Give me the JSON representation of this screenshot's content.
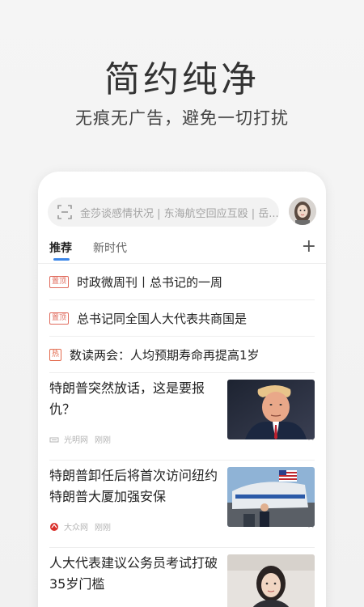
{
  "promo": {
    "title": "简约纯净",
    "subtitle": "无痕无广告，避免一切打扰"
  },
  "search": {
    "hint": "金莎谈感情状况 | 东海航空回应互殴 | 岳..."
  },
  "tabs": [
    {
      "label": "推荐"
    },
    {
      "label": "新时代"
    }
  ],
  "top_items": [
    {
      "tag": "置顶",
      "text": "时政微周刊丨总书记的一周"
    },
    {
      "tag": "置顶",
      "text": "总书记同全国人大代表共商国是"
    },
    {
      "tag": "热",
      "text": "数读两会：人均预期寿命再提高1岁"
    }
  ],
  "news": [
    {
      "title": "特朗普突然放话，这是要报仇？",
      "source": "光明网",
      "time": "刚刚"
    },
    {
      "title": "特朗普卸任后将首次访问纽约 特朗普大厦加强安保",
      "source": "大众网",
      "time": "刚刚"
    },
    {
      "title": "人大代表建议公务员考试打破35岁门槛",
      "source": "",
      "time": ""
    }
  ],
  "colors": {
    "accent": "#3b86e8",
    "tag_red": "#e06b5d"
  }
}
